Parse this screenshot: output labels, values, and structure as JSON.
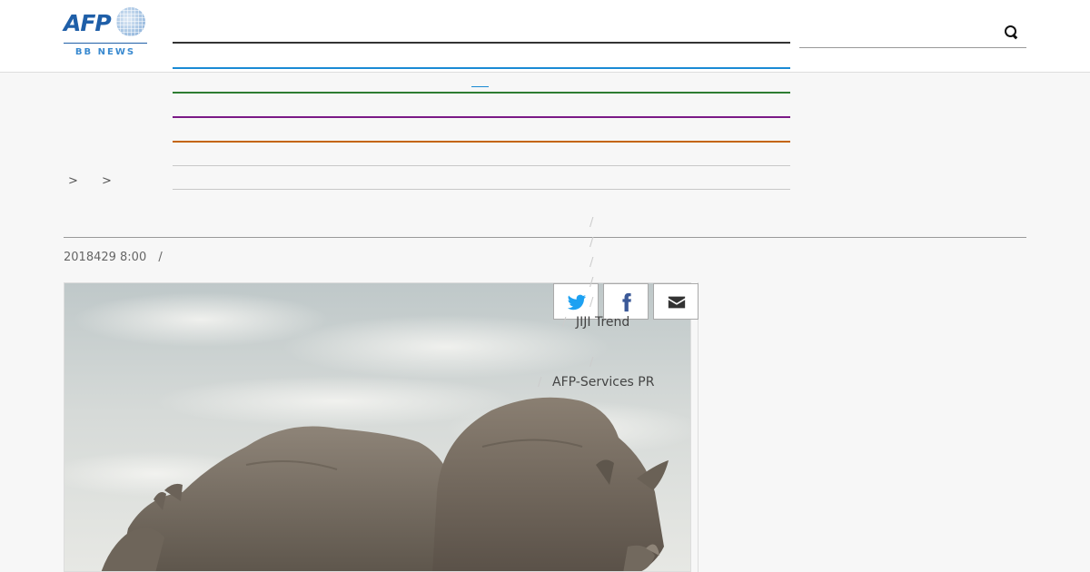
{
  "header": {
    "logo": {
      "brand": "AFP",
      "subtitle": "BB NEWS"
    },
    "nav_colors": [
      "#333333",
      "#1a8ad4",
      "#2e7d32",
      "#7b1a86",
      "#c4650a",
      "#c8c8c8",
      "#c8c8c8"
    ],
    "search": {
      "icon": "search-icon"
    }
  },
  "breadcrumb": {
    "separator": ">"
  },
  "article": {
    "title": "",
    "date": "2018429 8:00",
    "date_separator": "/"
  },
  "share": {
    "buttons": [
      {
        "icon": "twitter-icon",
        "color": "#1da1f2"
      },
      {
        "icon": "facebook-icon",
        "color": "#3b5998"
      },
      {
        "icon": "mail-icon",
        "color": "#333333"
      }
    ]
  },
  "dropdown": {
    "separator": "/",
    "items": [
      "JIJI Trend",
      "AFP-Services PR"
    ]
  },
  "photo": {
    "description_hidden": true
  }
}
